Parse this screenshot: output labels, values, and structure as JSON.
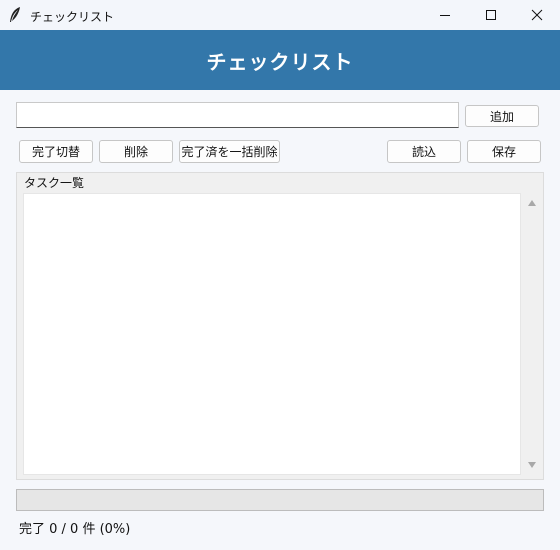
{
  "window": {
    "title": "チェックリスト",
    "icon": "feather-icon"
  },
  "header": {
    "title": "チェックリスト",
    "background": "#3377aa"
  },
  "input": {
    "value": "",
    "placeholder": ""
  },
  "toolbar": {
    "add_label": "追加",
    "toggle_label": "完了切替",
    "delete_label": "削除",
    "clear_done_label": "完了済を一括削除",
    "load_label": "読込",
    "save_label": "保存"
  },
  "task_list": {
    "label": "タスク一覧",
    "items": []
  },
  "progress": {
    "fraction": 0
  },
  "status": {
    "text": "完了 0 / 0 件 (0%)"
  }
}
